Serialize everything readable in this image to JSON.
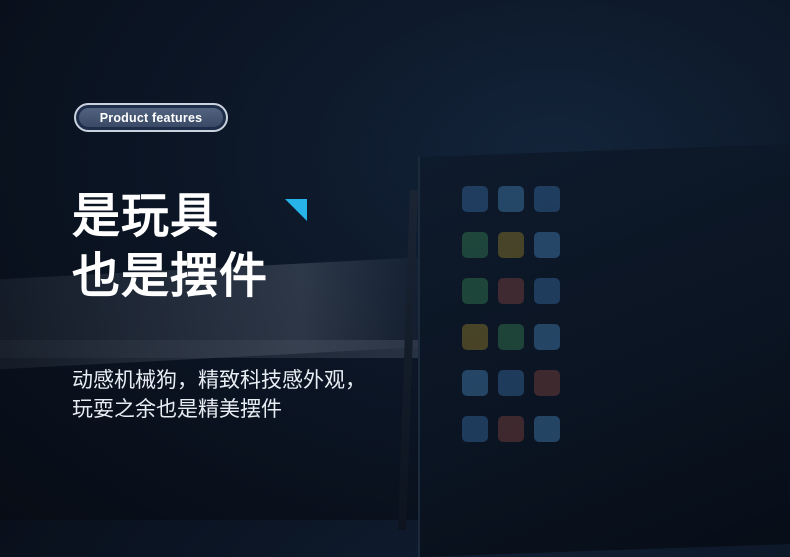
{
  "badge": {
    "label": "Product features"
  },
  "title": {
    "line1": "是玩具",
    "line2": "也是摆件"
  },
  "description": {
    "line1": "动感机械狗，精致科技感外观，",
    "line2": "玩耍之余也是精美摆件"
  },
  "colors": {
    "accent": "#27b2e8",
    "background": "#0c1626",
    "badge_fill": "#3a4a66",
    "badge_border": "#c9d2de"
  },
  "icons": [
    "triangle-accent-icon"
  ]
}
